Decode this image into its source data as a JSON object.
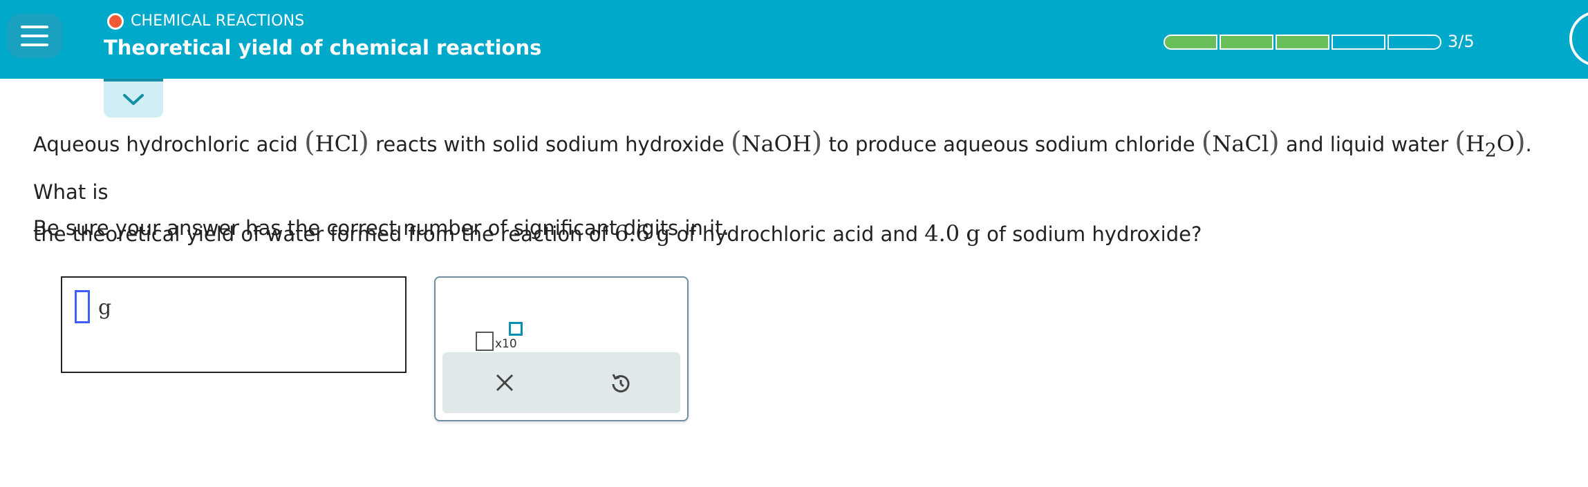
{
  "header": {
    "topic": "CHEMICAL REACTIONS",
    "title": "Theoretical yield of chemical reactions",
    "progress": {
      "label": "3/5",
      "completed": 3,
      "total": 5
    },
    "colors": {
      "header_bg": "#00a9ca",
      "topic_dot": "#f25a36",
      "progress_done": "#6bbf5b"
    }
  },
  "question": {
    "p1_a": "Aqueous hydrochloric acid",
    "hcl": "HCl",
    "p1_b": "reacts with solid sodium hydroxide",
    "naoh": "NaOH",
    "p1_c": "to produce aqueous sodium chloride",
    "nacl": "NaCl",
    "p1_d": "and liquid water",
    "h2o_h": "H",
    "h2o_sub": "2",
    "h2o_o": "O",
    "p1_e": ". What is",
    "p2_a": "the theoretical yield of water formed from the reaction of",
    "mass1": "6.6",
    "unit_g1": "g",
    "p2_b": "of hydrochloric acid and",
    "mass2": "4.0",
    "unit_g2": "g",
    "p2_c": "of sodium hydroxide?",
    "instruction": "Be sure your answer has the correct number of significant digits in it."
  },
  "answer": {
    "value": "",
    "unit": "g"
  },
  "tools": {
    "sci_notation_label": "x10",
    "icons": [
      "sci-notation-icon",
      "clear-icon",
      "undo-icon"
    ]
  }
}
